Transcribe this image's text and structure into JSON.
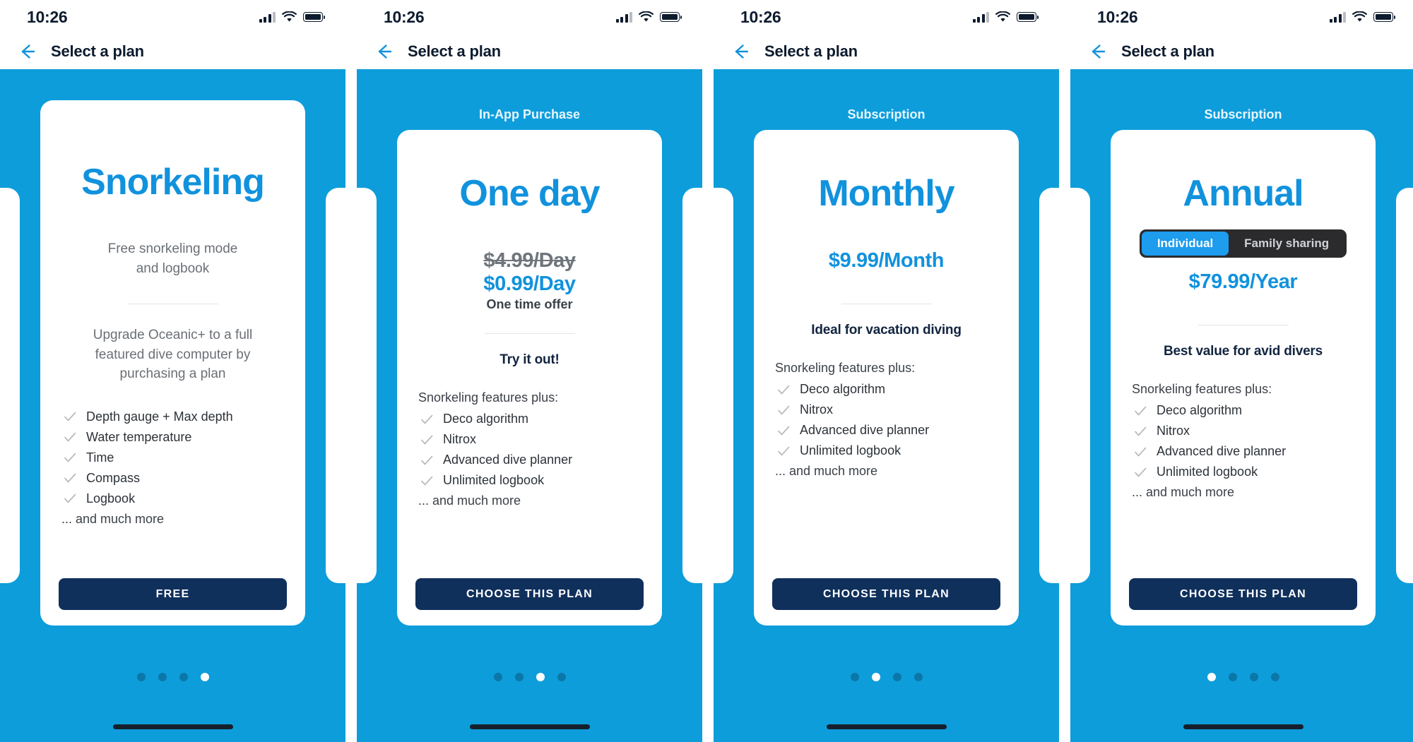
{
  "status_bar": {
    "time": "10:26",
    "icons": [
      "signal-icon",
      "wifi-icon",
      "battery-icon"
    ]
  },
  "nav": {
    "title": "Select a plan",
    "back_icon": "arrow-left-icon"
  },
  "colors": {
    "brand_blue": "#0d9ddb",
    "title_blue": "#1192dd",
    "cta_navy": "#10305c",
    "segment_track": "#2b2b2d",
    "segment_active": "#1e9cee"
  },
  "panels": [
    {
      "kicker": "",
      "plan_name": "Snorkeling",
      "sub_desc": "Free snorkeling mode\nand logbook",
      "price_old": "",
      "price_new": "",
      "price_note": "",
      "tagline": "",
      "upgrade_text": "Upgrade Oceanic+ to a full featured dive computer by purchasing a plan",
      "feat_intro": "",
      "features": [
        "Depth gauge + Max depth",
        "Water temperature",
        "Time",
        "Compass",
        "Logbook"
      ],
      "feat_more": "... and much more",
      "cta_label": "FREE",
      "dots": {
        "count": 4,
        "active": 4
      },
      "segmented": null
    },
    {
      "kicker": "In-App Purchase",
      "plan_name": "One day",
      "sub_desc": "",
      "price_old": "$4.99/Day",
      "price_new": "$0.99/Day",
      "price_note": "One time offer",
      "tagline": "Try it out!",
      "upgrade_text": "",
      "feat_intro": "Snorkeling features plus:",
      "features": [
        "Deco algorithm",
        "Nitrox",
        "Advanced dive planner",
        "Unlimited logbook"
      ],
      "feat_more": "... and much more",
      "cta_label": "CHOOSE THIS PLAN",
      "dots": {
        "count": 4,
        "active": 3
      },
      "segmented": null
    },
    {
      "kicker": "Subscription",
      "plan_name": "Monthly",
      "sub_desc": "",
      "price_old": "",
      "price_new": "$9.99/Month",
      "price_note": "",
      "tagline": "Ideal for vacation diving",
      "upgrade_text": "",
      "feat_intro": "Snorkeling features plus:",
      "features": [
        "Deco algorithm",
        "Nitrox",
        "Advanced dive planner",
        "Unlimited logbook"
      ],
      "feat_more": "... and much more",
      "cta_label": "CHOOSE THIS PLAN",
      "dots": {
        "count": 4,
        "active": 2
      },
      "segmented": null
    },
    {
      "kicker": "Subscription",
      "plan_name": "Annual",
      "sub_desc": "",
      "price_old": "",
      "price_new": "$79.99/Year",
      "price_note": "",
      "tagline": "Best value for avid divers",
      "upgrade_text": "",
      "feat_intro": "Snorkeling features plus:",
      "features": [
        "Deco algorithm",
        "Nitrox",
        "Advanced dive planner",
        "Unlimited logbook"
      ],
      "feat_more": "... and much more",
      "cta_label": "CHOOSE THIS PLAN",
      "dots": {
        "count": 4,
        "active": 1
      },
      "segmented": {
        "options": [
          "Individual",
          "Family sharing"
        ],
        "active": 0
      }
    }
  ]
}
